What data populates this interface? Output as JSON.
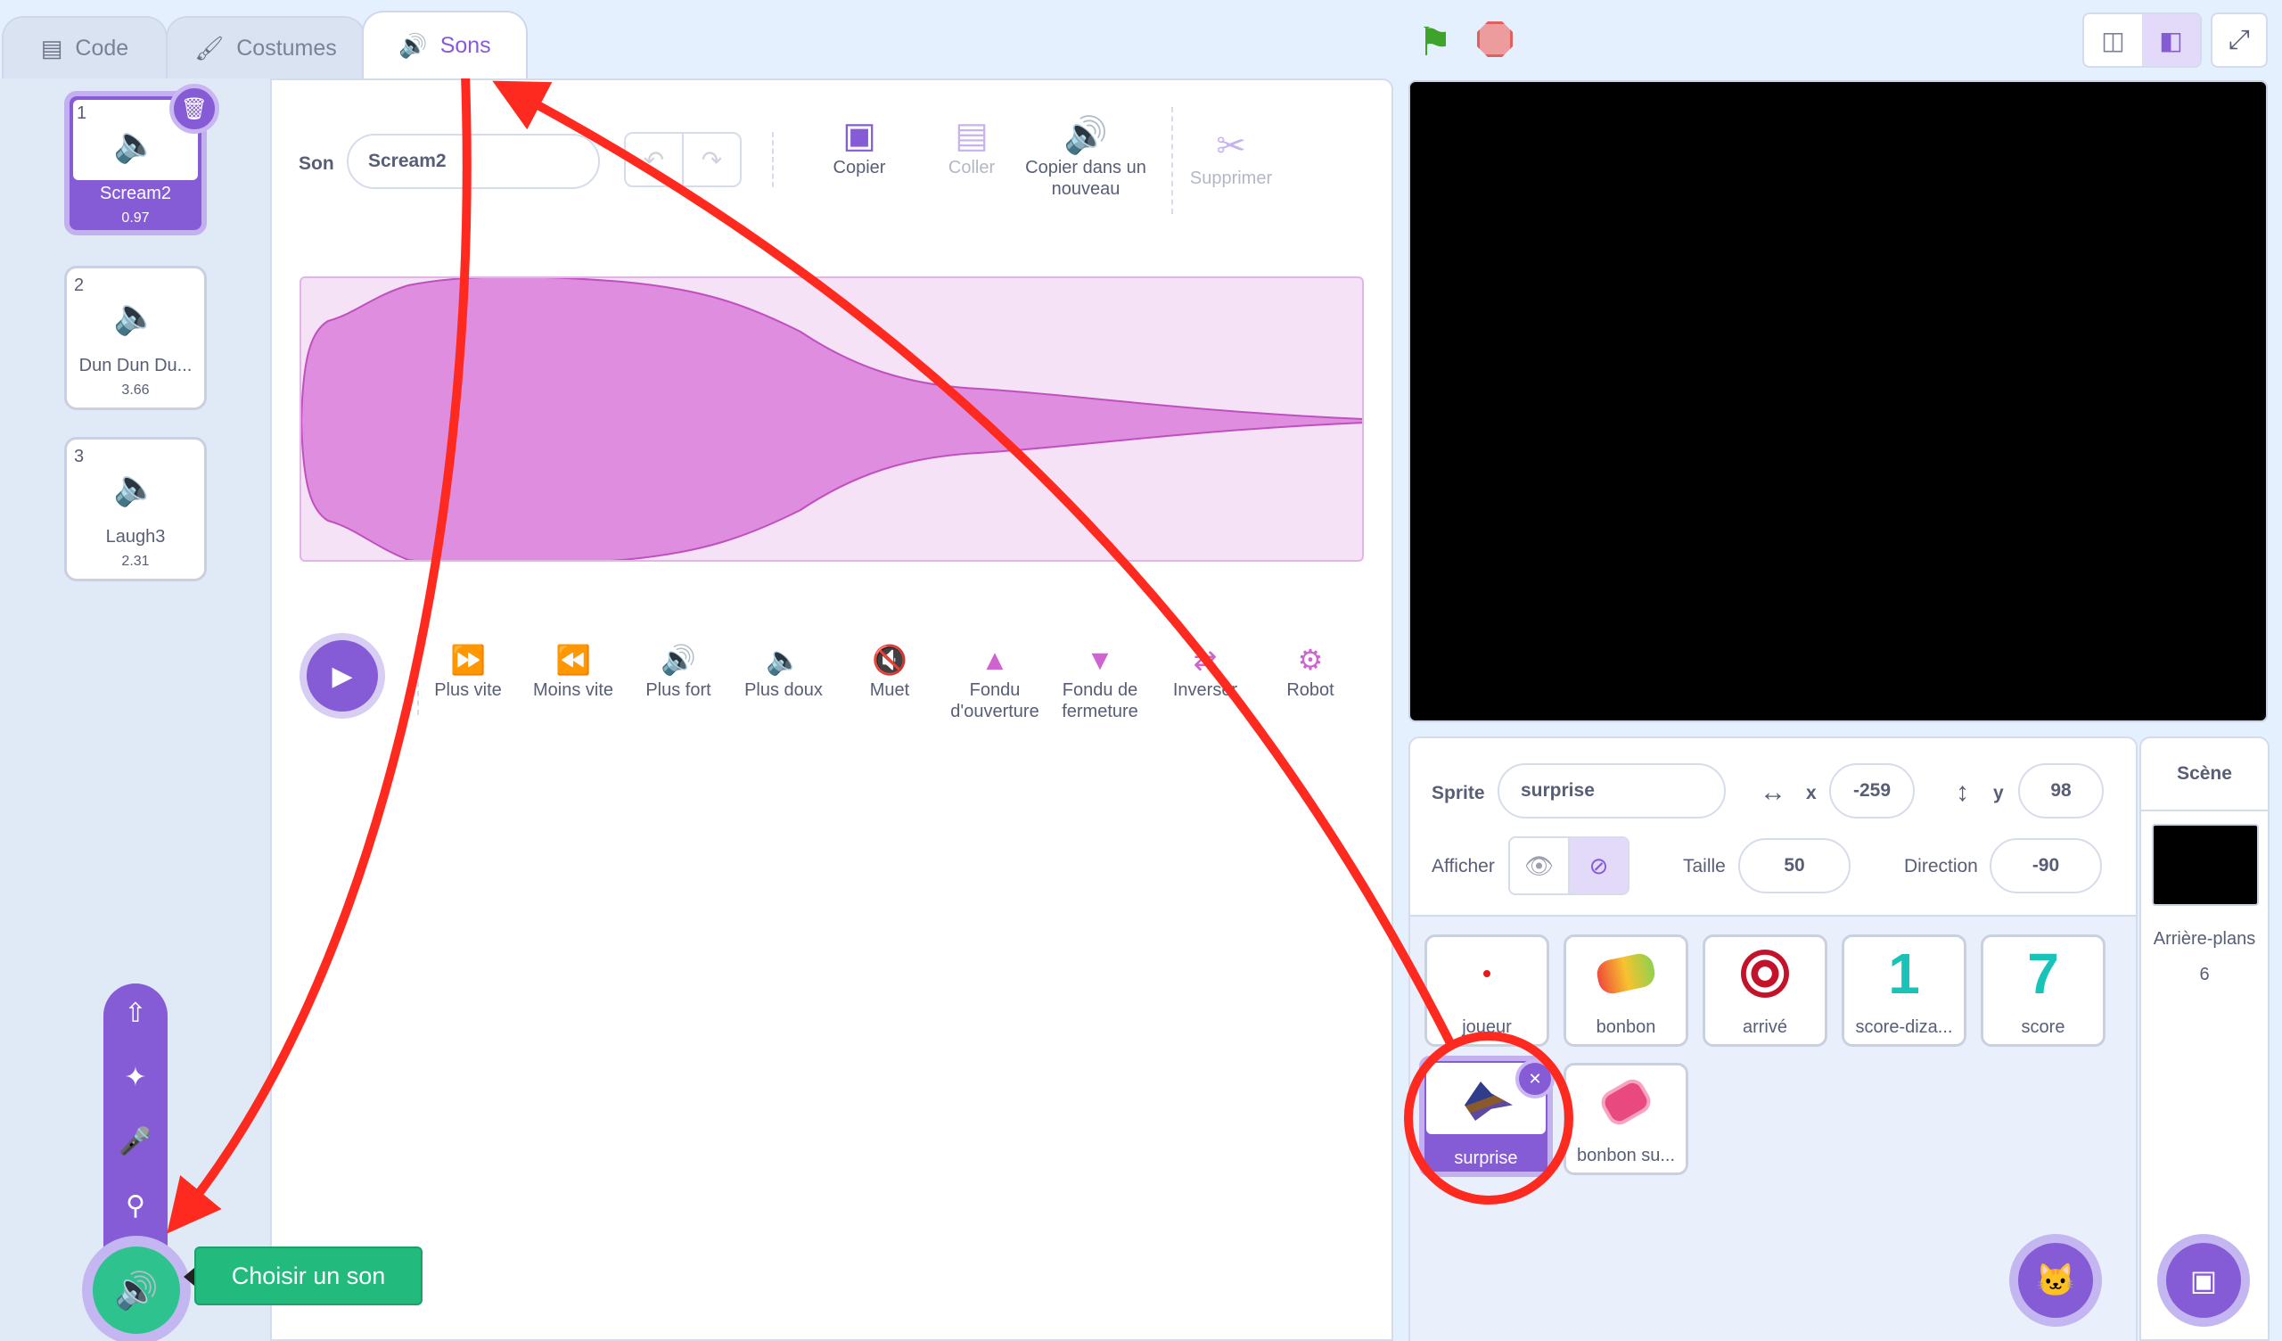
{
  "tabs": [
    {
      "label": "Code",
      "icon": "code-icon"
    },
    {
      "label": "Costumes",
      "icon": "brush-icon"
    },
    {
      "label": "Sons",
      "icon": "speaker-icon"
    }
  ],
  "sounds": [
    {
      "index": "1",
      "name": "Scream2",
      "duration": "0.97",
      "selected": true
    },
    {
      "index": "2",
      "name": "Dun Dun Du...",
      "duration": "3.66"
    },
    {
      "index": "3",
      "name": "Laugh3",
      "duration": "2.31"
    }
  ],
  "editor": {
    "sound_label": "Son",
    "sound_name": "Scream2",
    "tools": [
      {
        "label": "Copier",
        "icon": "copy-icon"
      },
      {
        "label": "Coller",
        "icon": "paste-icon"
      },
      {
        "label": "Copier dans un nouveau",
        "icon": "copy-new-icon"
      },
      {
        "label": "Supprimer",
        "icon": "scissors-icon"
      }
    ],
    "effects": [
      {
        "label": "Plus vite",
        "icon": "faster-icon"
      },
      {
        "label": "Moins vite",
        "icon": "slower-icon"
      },
      {
        "label": "Plus fort",
        "icon": "louder-icon"
      },
      {
        "label": "Plus doux",
        "icon": "softer-icon"
      },
      {
        "label": "Muet",
        "icon": "mute-icon"
      },
      {
        "label": "Fondu d'ouverture",
        "icon": "fade-in-icon"
      },
      {
        "label": "Fondu de fermeture",
        "icon": "fade-out-icon"
      },
      {
        "label": "Inverser",
        "icon": "reverse-icon"
      },
      {
        "label": "Robot",
        "icon": "robot-icon"
      }
    ]
  },
  "add_sound": {
    "tooltip": "Choisir un son",
    "menu_icons": [
      "upload-icon",
      "surprise-icon",
      "microphone-icon",
      "search-icon"
    ]
  },
  "sprite_info": {
    "sprite_label": "Sprite",
    "sprite_name": "surprise",
    "x_label": "x",
    "x_value": "-259",
    "y_label": "y",
    "y_value": "98",
    "show_label": "Afficher",
    "size_label": "Taille",
    "size_value": "50",
    "direction_label": "Direction",
    "direction_value": "-90"
  },
  "sprites": [
    {
      "name": "joueur",
      "icon": "red-dot-icon"
    },
    {
      "name": "bonbon",
      "icon": "candy-icon"
    },
    {
      "name": "arrivé",
      "icon": "candy-wrap-icon"
    },
    {
      "name": "score-diza...",
      "icon": "digit-one-icon"
    },
    {
      "name": "score",
      "icon": "digit-seven-icon"
    },
    {
      "name": "surprise",
      "icon": "witch-icon",
      "selected": true
    },
    {
      "name": "bonbon su...",
      "icon": "candy-pink-icon"
    }
  ],
  "stage_panel": {
    "title": "Scène",
    "backdrops_label": "Arrière-plans",
    "backdrops_count": "6"
  },
  "colors": {
    "accent": "#855cd6",
    "accent_light": "#c4b0ef",
    "wave": "#cf63cf",
    "add_green": "#2ec28f",
    "annotation_red": "#ff2a1f"
  }
}
